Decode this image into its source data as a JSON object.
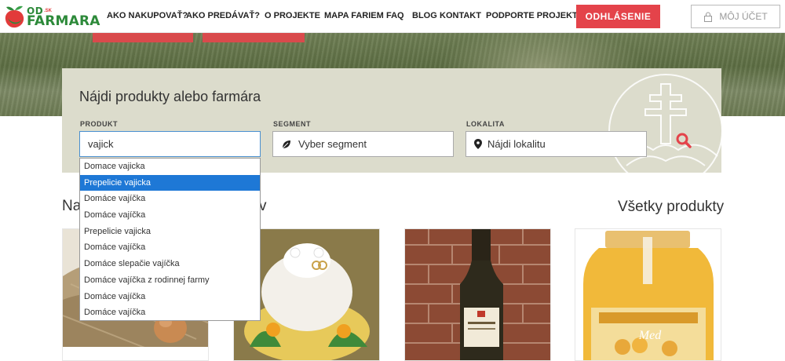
{
  "brand": {
    "od": "OD",
    "sk": ".SK",
    "farmara": "FARMARA"
  },
  "nav": [
    {
      "label": "AKO NAKUPOVAŤ?",
      "w": 101
    },
    {
      "label": "AKO PREDÁVAŤ?",
      "w": 100
    },
    {
      "label": "O PROJEKTE",
      "w": 76
    },
    {
      "label": "MAPA FARIEM",
      "w": 79
    },
    {
      "label": "FAQ",
      "w": 33
    },
    {
      "label": "BLOG",
      "w": 35
    },
    {
      "label": "KONTAKT",
      "w": 59
    },
    {
      "label": "PODPORTE PROJEKT",
      "w": 113
    }
  ],
  "header": {
    "logout_label": "ODHLÁSENIE",
    "account_label": "MÔJ ÚČET"
  },
  "search": {
    "title": "Nájdi produkty alebo farmára",
    "product_label": "PRODUKT",
    "product_value": "vajick",
    "segment_label": "SEGMENT",
    "segment_placeholder": "Vyber segment",
    "location_label": "LOKALITA",
    "location_placeholder": "Nájdi lokalitu"
  },
  "suggestions": [
    "Domace vajicka",
    "Prepelicie vajicka",
    "Domáce vajíčka",
    "Domáce vajíčka",
    "Prepelicie vajicka",
    "Domáce vajíčka",
    "Domáce slepačie vajíčka",
    "Domáce vajíčka z rodinnej farmy",
    "Domáce vajíčka",
    "Domáce vajíčka"
  ],
  "selected_suggestion_index": 1,
  "sections": {
    "left_partial_1": "Na",
    "left_partial_2": "v",
    "all_products": "Všetky produkty"
  },
  "colors": {
    "brand_green": "#2d8a3a",
    "accent_red": "#e4434a",
    "panel_bg": "#dcdccc",
    "selected_blue": "#1e78d6"
  }
}
